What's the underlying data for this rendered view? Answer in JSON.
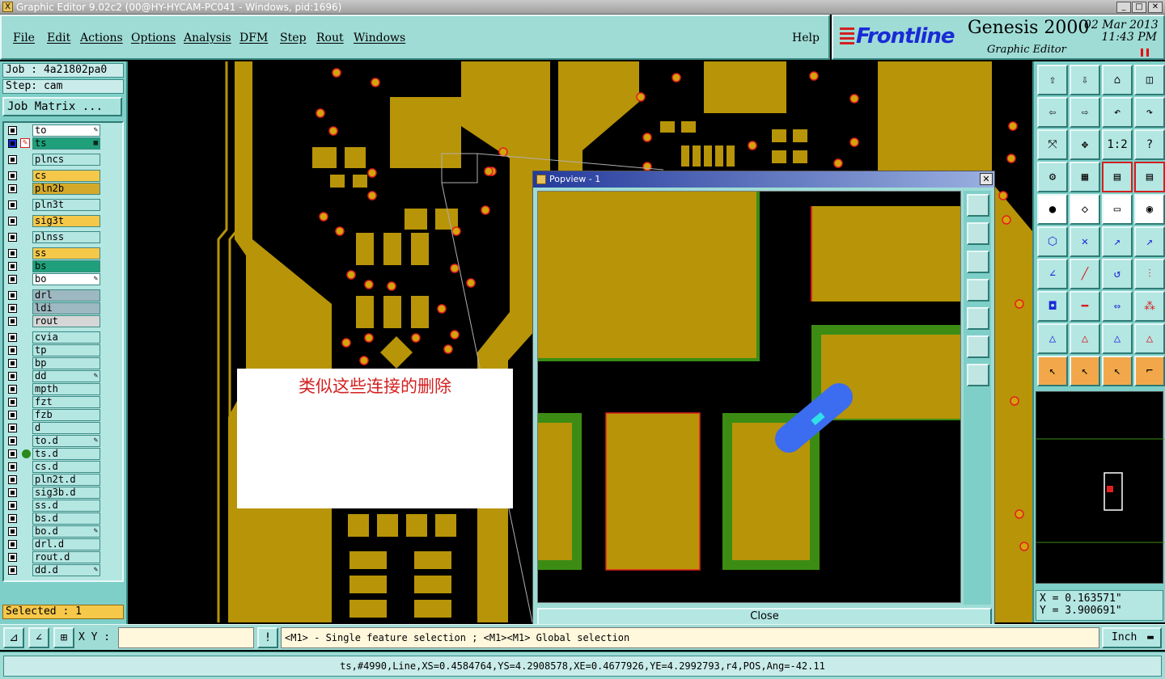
{
  "window": {
    "title": "Graphic Editor 9.02c2 (00@HY-HYCAM-PC041 - Windows, pid:1696)"
  },
  "menu": {
    "items": [
      "File",
      "Edit",
      "Actions",
      "Options",
      "Analysis",
      "DFM",
      "Step",
      "Rout",
      "Windows"
    ],
    "help": "Help"
  },
  "brand": {
    "logo": "Frontline",
    "product": "Genesis 2000",
    "subtitle": "Graphic Editor",
    "date": "02 Mar 2013",
    "time": "11:43 PM"
  },
  "job": {
    "job": "Job : 4a21802pa0",
    "step": "Step: cam",
    "matrix_button": "Job Matrix ..."
  },
  "layers": [
    {
      "name": "to",
      "color": "#ffffff",
      "flag": "✎"
    },
    {
      "name": "ts",
      "color": "#1fa07a",
      "flag": "▦",
      "active": true
    },
    {
      "name": "plncs",
      "color": "#b4e6e2"
    },
    {
      "name": "cs",
      "color": "#f6c84a"
    },
    {
      "name": "pln2b",
      "color": "#d4a92a"
    },
    {
      "name": "pln3t",
      "color": "#b4e6e2"
    },
    {
      "name": "sig3t",
      "color": "#f6c84a"
    },
    {
      "name": "plnss",
      "color": "#b4e6e2"
    },
    {
      "name": "ss",
      "color": "#f6c84a"
    },
    {
      "name": "bs",
      "color": "#1fa07a"
    },
    {
      "name": "bo",
      "color": "#ffffff",
      "flag": "✎"
    },
    {
      "name": "drl",
      "color": "#9db8c0"
    },
    {
      "name": "ldi",
      "color": "#9db8c0"
    },
    {
      "name": "rout",
      "color": "#d6d6d6"
    },
    {
      "name": "cvia",
      "color": "#b4e6e2"
    },
    {
      "name": "tp",
      "color": "#b4e6e2"
    },
    {
      "name": "bp",
      "color": "#b4e6e2"
    },
    {
      "name": "dd",
      "color": "#b4e6e2",
      "flag": "✎"
    },
    {
      "name": "mpth",
      "color": "#b4e6e2"
    },
    {
      "name": "fzt",
      "color": "#b4e6e2"
    },
    {
      "name": "fzb",
      "color": "#b4e6e2"
    },
    {
      "name": "d",
      "color": "#b4e6e2"
    },
    {
      "name": "to.d",
      "color": "#b4e6e2",
      "flag": "✎"
    },
    {
      "name": "ts.d",
      "color": "#b4e6e2",
      "dot": true
    },
    {
      "name": "cs.d",
      "color": "#b4e6e2"
    },
    {
      "name": "pln2t.d",
      "color": "#b4e6e2"
    },
    {
      "name": "sig3b.d",
      "color": "#b4e6e2"
    },
    {
      "name": "ss.d",
      "color": "#b4e6e2"
    },
    {
      "name": "bs.d",
      "color": "#b4e6e2"
    },
    {
      "name": "bo.d",
      "color": "#b4e6e2",
      "flag": "✎"
    },
    {
      "name": "drl.d",
      "color": "#b4e6e2"
    },
    {
      "name": "rout.d",
      "color": "#b4e6e2"
    },
    {
      "name": "dd.d",
      "color": "#b4e6e2",
      "flag": "✎"
    }
  ],
  "selected": "Selected : 1",
  "popup": {
    "title": "Popview - 1",
    "close_label": "Close",
    "close_x": "✕"
  },
  "annotation": {
    "text": "类似这些连接的删除"
  },
  "toolbar": {
    "icons": [
      "open-icon",
      "save-icon",
      "home-icon",
      "layout-icon",
      "import-icon",
      "export-icon",
      "undo-icon",
      "redo-icon",
      "zoom-fit-icon",
      "zoom-home-icon",
      "scale-icon",
      "help-icon",
      "tools-icon",
      "grid-icon",
      "traffic-icon",
      "traffic-red-icon",
      "add-pad-icon",
      "add-line-icon",
      "ruler-icon",
      "circle-icon",
      "connect-icon",
      "cross-icon",
      "arrow-red-icon",
      "arrow-blue-icon",
      "angle-icon",
      "slash-icon",
      "arc-icon",
      "rf-icon",
      "sel-pad-icon",
      "minus-icon",
      "measure-icon",
      "group-icon",
      "tri-a-icon",
      "tri-b-icon",
      "tri-c-icon",
      "tri-d-icon",
      "pointer-icon",
      "pointer-box-icon",
      "pointer-b-icon",
      "route-icon"
    ],
    "labels": {
      "scale": "1:2",
      "help": "?"
    }
  },
  "coords": {
    "x": "X = 0.163571\"",
    "y": "Y = 3.900691\""
  },
  "command": {
    "xy_label": "X Y :",
    "xy_value": "",
    "hint": "<M1> - Single feature selection ; <M1><M1> Global selection",
    "unit": "Inch",
    "bang": "!"
  },
  "status": "ts,#4990,Line,XS=0.4584764,YS=4.2908578,XE=0.4677926,YE=4.2992793,r4,POS,Ang=-42.11",
  "colors": {
    "copper": "#b89408",
    "board": "#000000",
    "panel": "#9fdcd6",
    "mask": "#3c8c14",
    "selection": "#3c6cf0",
    "pad_edge": "#e02020"
  }
}
